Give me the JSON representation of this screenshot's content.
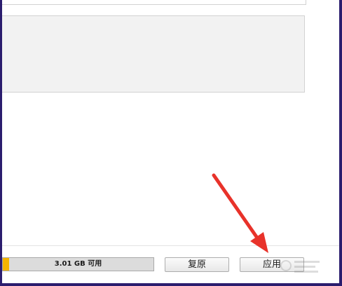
{
  "storage": {
    "available_label": "3.01 GB 可用",
    "used_fraction": 0.04
  },
  "buttons": {
    "restore_label": "复原",
    "apply_label": "应用"
  },
  "annotation": {
    "arrow_color": "#e8322a",
    "target": "apply-button"
  },
  "colors": {
    "frame": "#2b1d6e",
    "capacity_fill": "#f4b400",
    "panel": "#f2f2f2"
  }
}
